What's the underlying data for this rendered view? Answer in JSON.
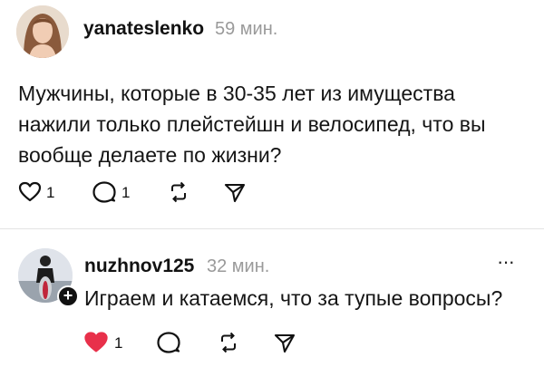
{
  "post": {
    "username": "yanateslenko",
    "time": "59 мин.",
    "text": "Мужчины, которые в 30-35 лет из имущества нажили только плейстейшн и велосипед, что вы вообще делаете по жизни?",
    "likes": "1",
    "replies": "1"
  },
  "reply": {
    "username": "nuzhnov125",
    "time": "32 мин.",
    "text": "Играем и катаемся, что за тупые вопросы?",
    "likes": "1",
    "more": "···",
    "follow": "+"
  },
  "colors": {
    "heart_active": "#e8304a",
    "meta_gray": "#9a9a9a"
  },
  "icons": [
    "heart-icon",
    "comment-icon",
    "repost-icon",
    "share-icon",
    "more-icon",
    "follow-plus-icon"
  ]
}
